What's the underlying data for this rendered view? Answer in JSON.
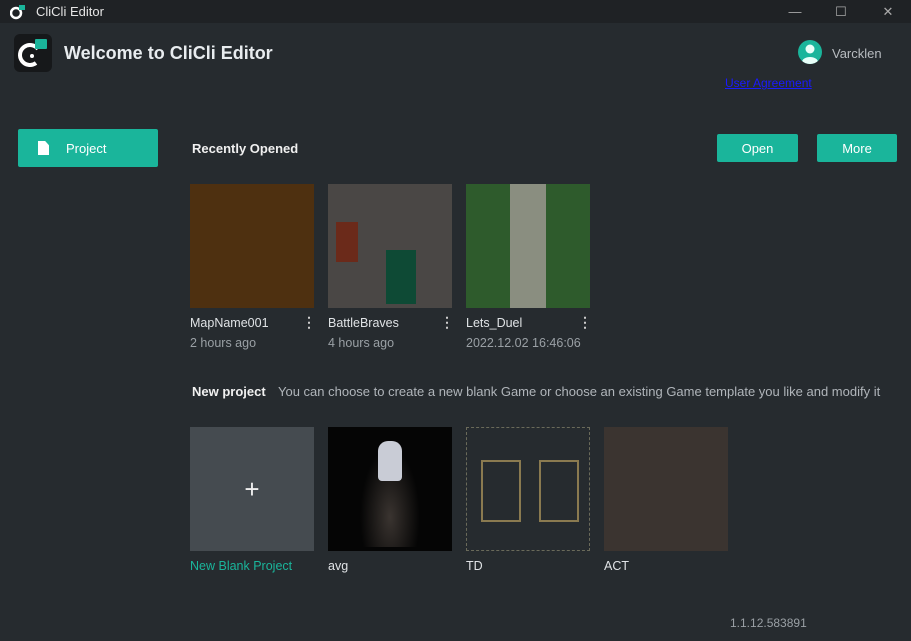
{
  "window": {
    "title": "CliCli Editor",
    "controls": [
      "—",
      "☐",
      "✕"
    ]
  },
  "header": {
    "welcome": "Welcome to CliCli Editor",
    "username": "Varcklen",
    "user_agreement": "User Agreement"
  },
  "sidebar": {
    "project_label": "Project"
  },
  "recent": {
    "title": "Recently Opened",
    "open_label": "Open",
    "more_label": "More",
    "items": [
      {
        "name": "MapName001",
        "time": "2 hours ago"
      },
      {
        "name": "BattleBraves",
        "time": "4 hours ago"
      },
      {
        "name": "Lets_Duel",
        "time": "2022.12.02 16:46:06"
      }
    ]
  },
  "new_project": {
    "title": "New project",
    "description": "You can choose to create a new blank Game or choose an existing Game template you like and modify it",
    "blank_label": "New Blank Project",
    "plus": "+",
    "templates": [
      {
        "name": "avg"
      },
      {
        "name": "TD"
      },
      {
        "name": "ACT"
      }
    ]
  },
  "version": "1.1.12.583891",
  "menu_glyph": "⋮"
}
